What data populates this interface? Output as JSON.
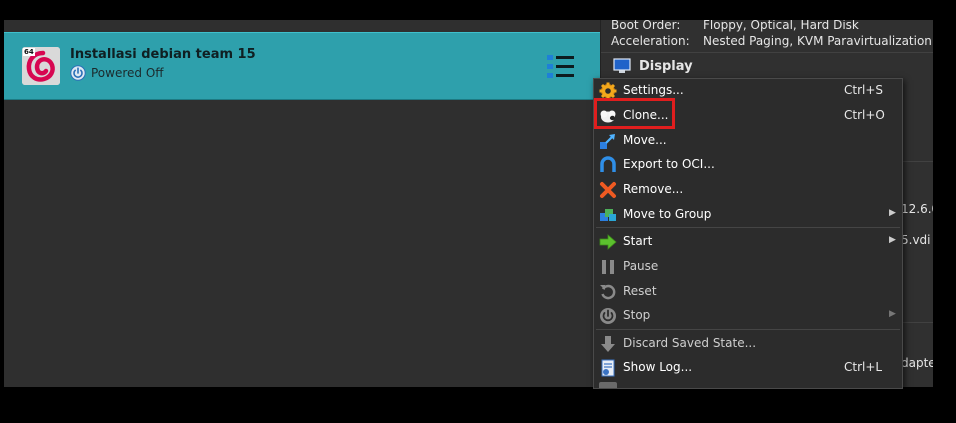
{
  "vm": {
    "name": "Installasi debian team 15",
    "status": "Powered Off",
    "badge": "64"
  },
  "details": {
    "boot_order_label": "Boot Order:",
    "boot_order_value": "Floppy, Optical, Hard Disk",
    "acceleration_label": "Acceleration:",
    "acceleration_value": "Nested Paging, KVM Paravirtualization",
    "display_title": "Display",
    "partial_1": "12.6.0",
    "partial_2": "5.vdi",
    "partial_3": "dapte"
  },
  "context_menu": {
    "items": [
      {
        "label": "Settings...",
        "shortcut": "Ctrl+S"
      },
      {
        "label": "Clone...",
        "shortcut": "Ctrl+O"
      },
      {
        "label": "Move...",
        "shortcut": ""
      },
      {
        "label": "Export to OCI...",
        "shortcut": ""
      },
      {
        "label": "Remove...",
        "shortcut": ""
      },
      {
        "label": "Move to Group",
        "shortcut": ""
      },
      {
        "label": "Start",
        "shortcut": ""
      },
      {
        "label": "Pause",
        "shortcut": ""
      },
      {
        "label": "Reset",
        "shortcut": ""
      },
      {
        "label": "Stop",
        "shortcut": ""
      },
      {
        "label": "Discard Saved State...",
        "shortcut": ""
      },
      {
        "label": "Show Log...",
        "shortcut": "Ctrl+L"
      }
    ],
    "submenu_arrow": "▶"
  },
  "colors": {
    "selected_row": "#2ea0ac",
    "highlight_box": "#e01e1e",
    "menu_bg": "#2c2c2c"
  }
}
